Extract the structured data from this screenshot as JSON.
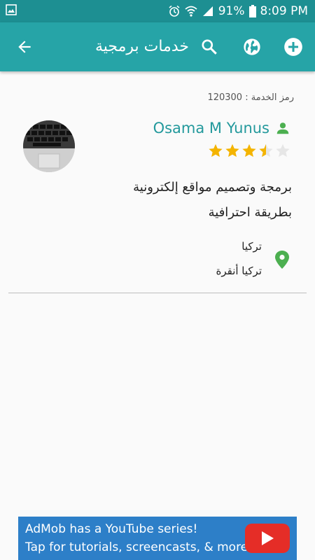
{
  "status_bar": {
    "battery": "91%",
    "time": "8:09 PM"
  },
  "app_bar": {
    "title": "خدمات برمجية"
  },
  "service": {
    "code_text": "رمز الخدمة : 120300",
    "provider_name": "Osama M Yunus",
    "rating": 3.5,
    "rating_max": 5,
    "description_line1": "برمجة وتصميم مواقع إلكترونية",
    "description_line2": "بطريقة احترافية",
    "location_line1": "تركيا",
    "location_line2": "تركيا أنقرة"
  },
  "ad": {
    "line1": "AdMob has a YouTube series!",
    "line2": "Tap for tutorials, screencasts, & more."
  },
  "colors": {
    "primary": "#26a4a7",
    "primary_dark": "#1d8f92",
    "accent_green": "#4caf50",
    "star": "#f4b400",
    "ad_blue": "#2d7fc8"
  }
}
